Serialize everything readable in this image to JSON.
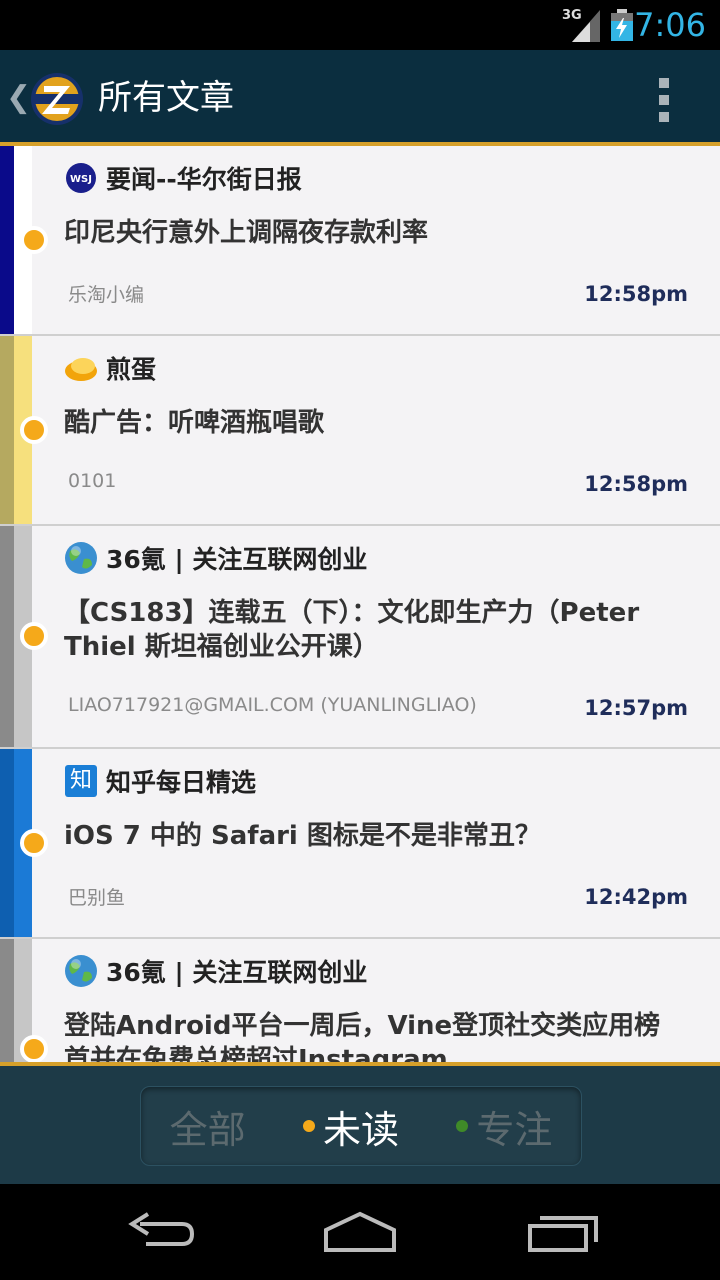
{
  "status_bar": {
    "network": "3G",
    "time": "7:06"
  },
  "action_bar": {
    "title": "所有文章"
  },
  "articles": [
    {
      "feed": "要闻--华尔街日报",
      "icon": "wsj-icon",
      "title": "印尼央行意外上调隔夜存款利率",
      "author": "乐淘小编",
      "time": "12:58pm",
      "stripe_outer": "#0a0a8a",
      "stripe_inner": "#ffffff"
    },
    {
      "feed": "煎蛋",
      "icon": "jiandan-icon",
      "title": "酷广告：听啤酒瓶唱歌",
      "author": "0101",
      "time": "12:58pm",
      "stripe_outer": "#b5a960",
      "stripe_inner": "#f6e07d"
    },
    {
      "feed": "36氪 | 关注互联网创业",
      "icon": "globe-icon",
      "title": "【CS183】连载五（下）：文化即生产力（Peter Thiel 斯坦福创业公开课）",
      "author": "LIAO717921@GMAIL.COM (YUANLINGLIAO)",
      "time": "12:57pm",
      "stripe_outer": "#8a8a8a",
      "stripe_inner": "#c6c6c6"
    },
    {
      "feed": "知乎每日精选",
      "icon": "zhihu-icon",
      "title": "iOS 7 中的 Safari 图标是不是非常丑？",
      "author": "巴别鱼",
      "time": "12:42pm",
      "stripe_outer": "#0e5fb0",
      "stripe_inner": "#1b7ad6"
    },
    {
      "feed": "36氪 | 关注互联网创业",
      "icon": "globe-icon",
      "title": "登陆Android平台一周后，Vine登顶社交类应用榜首并在免费总榜超过Instagram",
      "author": "",
      "time": "",
      "stripe_outer": "#8a8a8a",
      "stripe_inner": "#c6c6c6"
    }
  ],
  "filter": {
    "all": "全部",
    "unread": "未读",
    "starred": "专注",
    "unread_dot_color": "#f5a91a",
    "starred_dot_color": "#3f8a28"
  },
  "zhihu_glyph": "知",
  "wsj_glyph": "WSJ"
}
